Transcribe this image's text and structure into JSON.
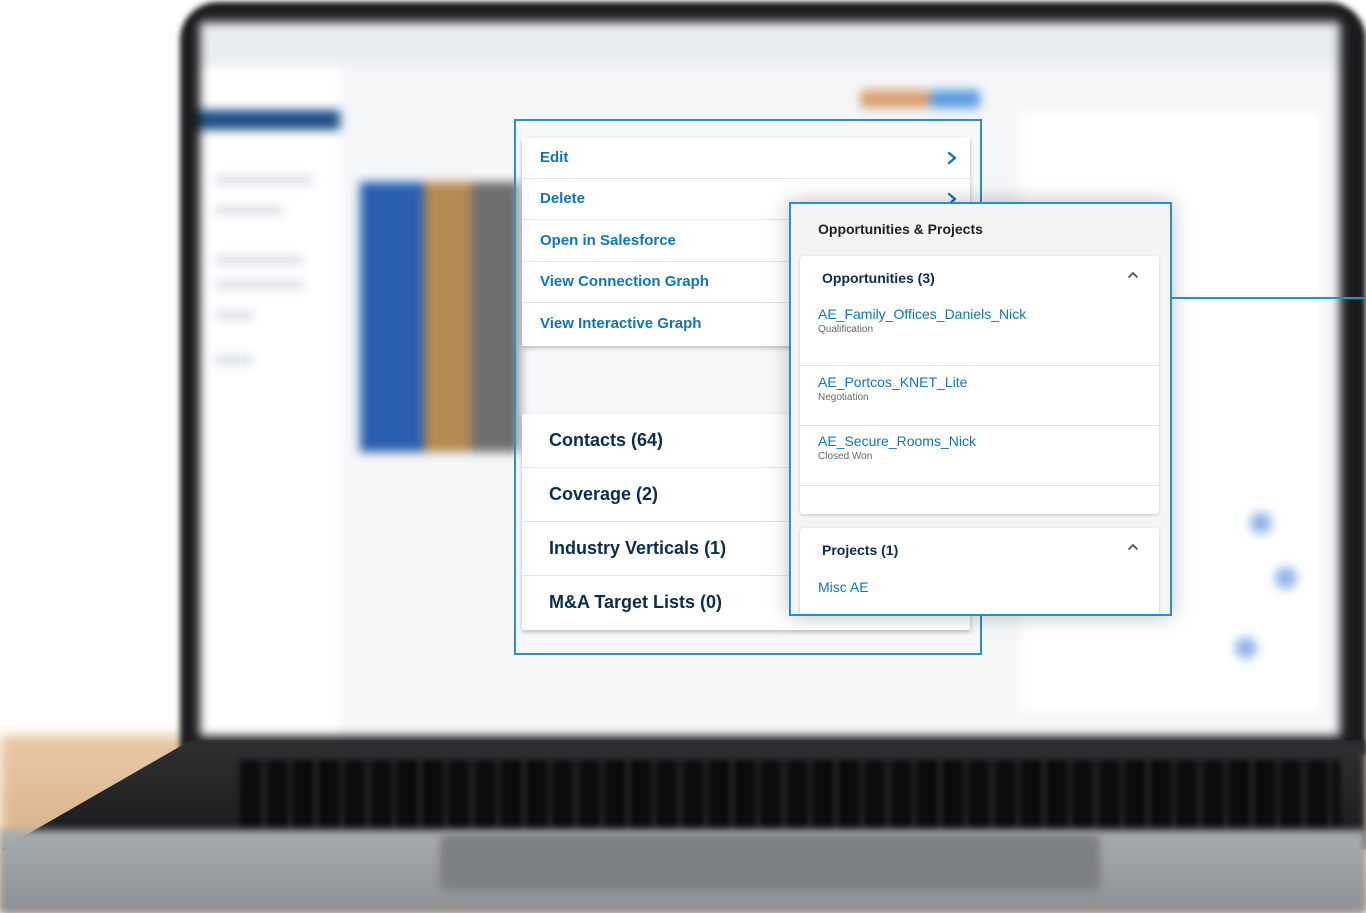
{
  "menu": {
    "items": [
      {
        "label": "Edit",
        "chevron": true
      },
      {
        "label": "Delete",
        "chevron": true
      },
      {
        "label": "Open in Salesforce",
        "chevron": false
      },
      {
        "label": "View Connection Graph",
        "chevron": false
      },
      {
        "label": "View Interactive Graph",
        "chevron": false
      }
    ]
  },
  "related_lists": [
    {
      "label": "Contacts (64)"
    },
    {
      "label": "Coverage (2)"
    },
    {
      "label": "Industry Verticals (1)"
    },
    {
      "label": "M&A Target Lists (0)"
    }
  ],
  "popover": {
    "title": "Opportunities & Projects",
    "opportunities": {
      "header": "Opportunities (3)",
      "items": [
        {
          "name": "AE_Family_Offices_Daniels_Nick",
          "stage": "Qualification"
        },
        {
          "name": "AE_Portcos_KNET_Lite",
          "stage": "Negotiation"
        },
        {
          "name": "AE_Secure_Rooms_Nick",
          "stage": "Closed Won"
        }
      ]
    },
    "projects": {
      "header": "Projects (1)",
      "items": [
        {
          "name": "Misc AE"
        }
      ]
    }
  },
  "colors": {
    "link": "#1473b8",
    "heading": "#0b2c4d",
    "accent_border": "#2c8fbf"
  }
}
